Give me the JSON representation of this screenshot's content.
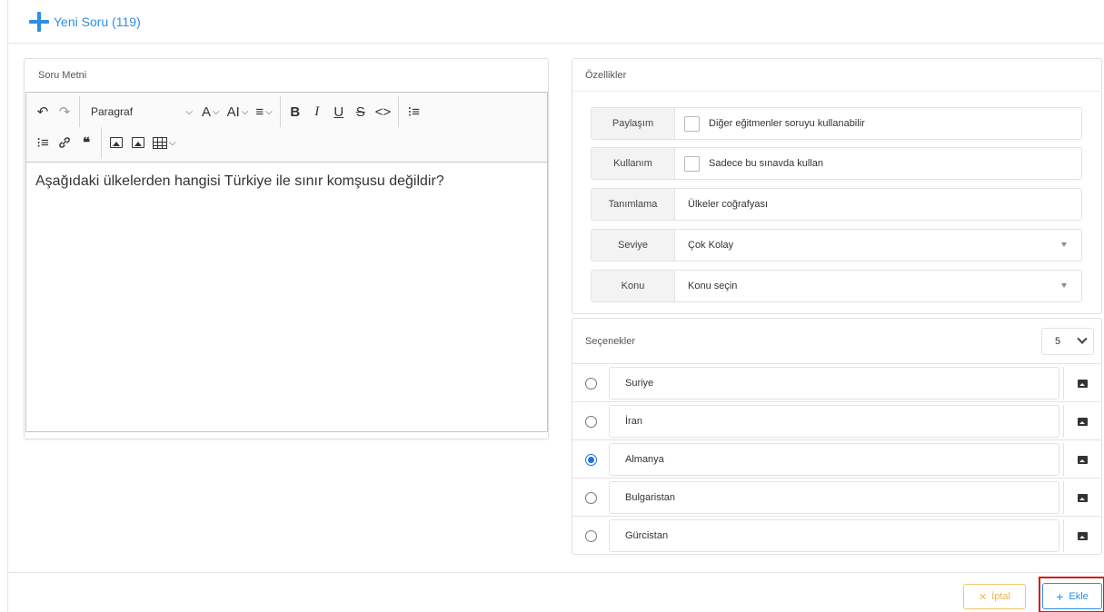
{
  "header": {
    "title": "Yeni Soru (119)"
  },
  "editor_panel": {
    "title": "Soru Metni",
    "toolbar": {
      "undo": "↶",
      "redo": "↷",
      "paragraph_select": "Paragraf",
      "font_size": "A",
      "font_family": "AI",
      "align": "≡",
      "bold": "B",
      "italic": "I",
      "underline": "U",
      "strike": "S",
      "code": "<>",
      "bullet_list": "⁝≡",
      "numbered_list": "⁝≡",
      "link": "🔗",
      "quote": "❝"
    },
    "content": "Aşağıdaki ülkelerden hangisi Türkiye ile sınır komşusu değildir?"
  },
  "properties": {
    "title": "Özellikler",
    "rows": [
      {
        "label": "Paylaşım",
        "value": "Diğer eğitmenler soruyu kullanabilir"
      },
      {
        "label": "Kullanım",
        "value": "Sadece bu sınavda kullan"
      },
      {
        "label": "Tanımlama",
        "value": "Ülkeler coğrafyası"
      },
      {
        "label": "Seviye",
        "value": "Çok Kolay"
      },
      {
        "label": "Konu",
        "value": "Konu seçin"
      }
    ]
  },
  "options": {
    "title": "Seçenekler",
    "count": "5",
    "items": [
      {
        "text": "Suriye",
        "checked": false
      },
      {
        "text": "İran",
        "checked": false
      },
      {
        "text": "Almanya",
        "checked": true
      },
      {
        "text": "Bulgaristan",
        "checked": false
      },
      {
        "text": "Gürcistan",
        "checked": false
      }
    ]
  },
  "footer": {
    "cancel_label": "İptal",
    "add_label": "Ekle"
  },
  "colors": {
    "accent": "#2d8ee6",
    "cancel": "#f3b54a",
    "highlight": "#d81a1a",
    "radio": "#1a73e8"
  }
}
